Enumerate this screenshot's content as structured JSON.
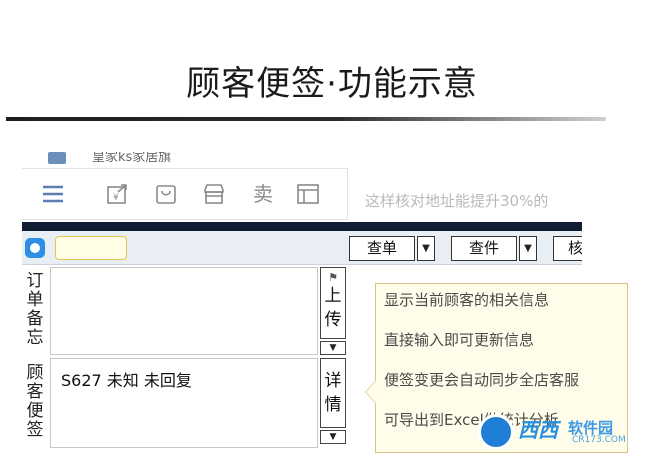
{
  "slide": {
    "title": "顾客便签·功能示意"
  },
  "app": {
    "shop_name": "皇家ks家居旗",
    "toolbar": {
      "icons": [
        "menu-icon",
        "export-icon",
        "bag-icon",
        "shop-icon",
        "sell-icon",
        "window-icon"
      ],
      "sell_glyph": "卖"
    },
    "hint": "这样核对地址能提升30%的",
    "buttons": {
      "check_order": "查单",
      "check_item": "查件",
      "verify": "核",
      "dropdown": "▼"
    },
    "order_memo": {
      "label": "订单备忘",
      "value": "",
      "upload_button": "上传"
    },
    "customer_note": {
      "label": "顾客便签",
      "value": "S627 未知 未回复",
      "details_button": "详情"
    }
  },
  "callout": {
    "lines": [
      "显示当前顾客的相关信息",
      "直接输入即可更新信息",
      "便签变更会自动同步全店客服",
      "可导出到Excel做统计分析"
    ]
  },
  "watermark": {
    "brand": "西西",
    "sub": "软件园",
    "url": "CR173.COM"
  },
  "colors": {
    "accent": "#2d8ee8",
    "dark_bar": "#0f1e33",
    "callout_bg": "#fffde9"
  }
}
